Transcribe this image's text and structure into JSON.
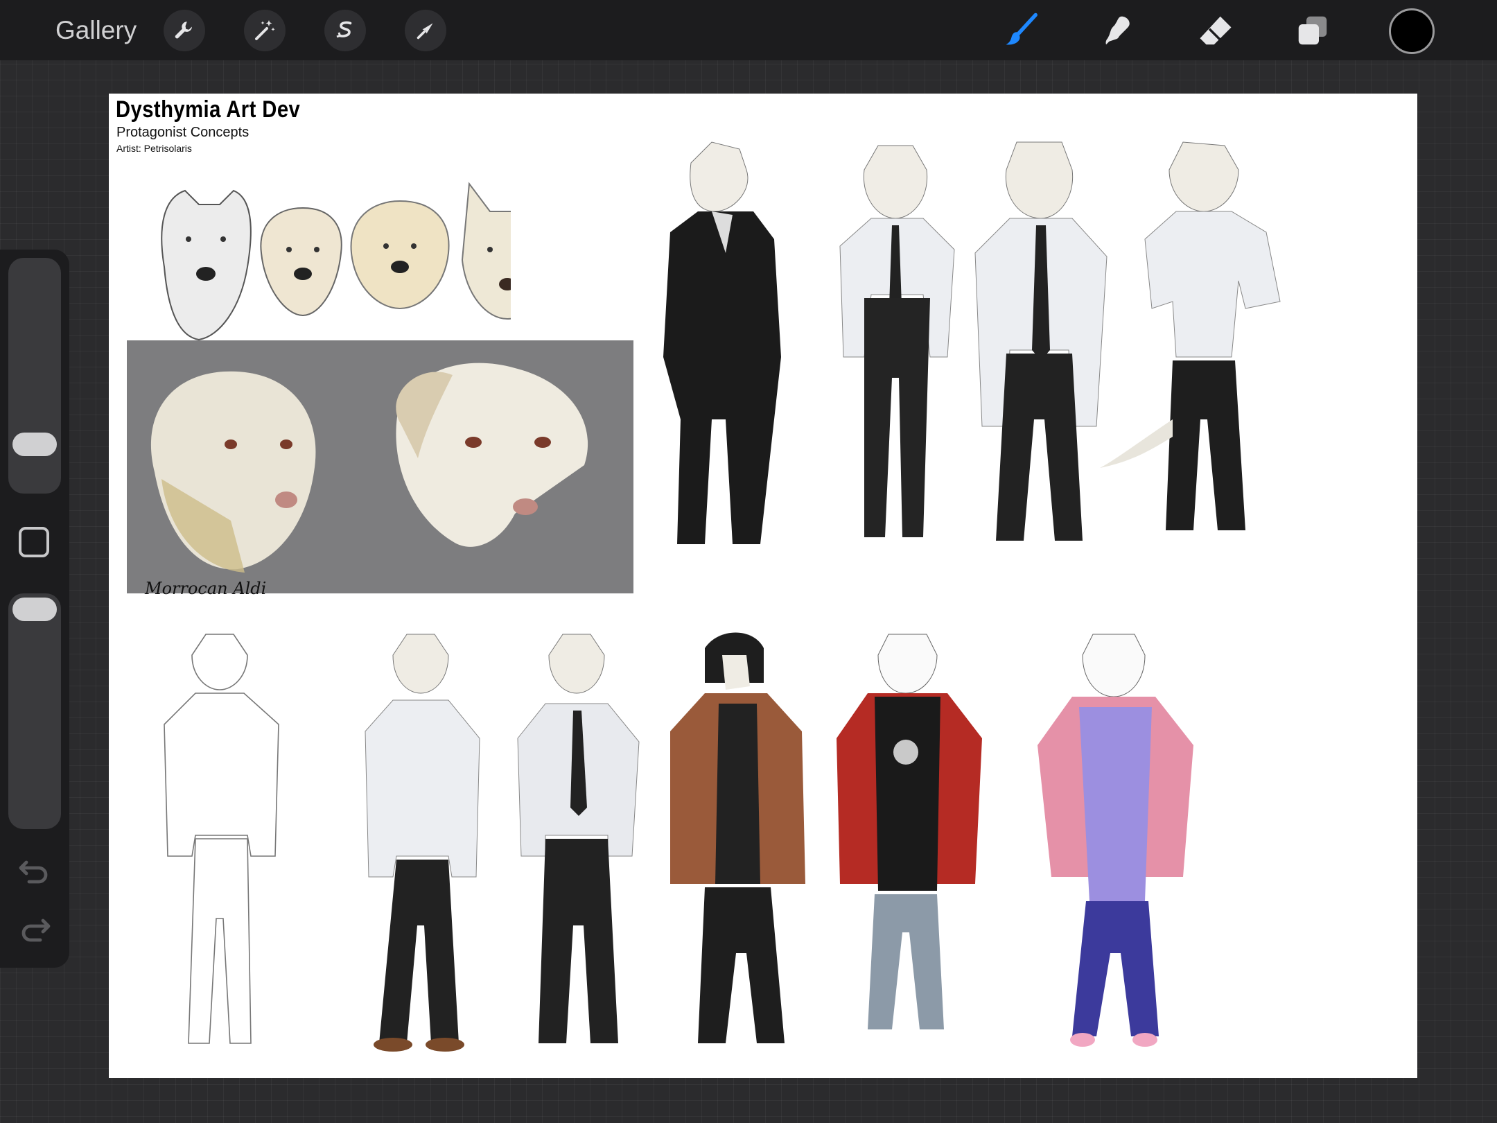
{
  "toolbar": {
    "gallery_label": "Gallery",
    "left_tools": [
      "wrench-icon",
      "magic-wand-icon",
      "selection-icon",
      "transform-icon"
    ],
    "right_tools": [
      "brush-icon",
      "smudge-icon",
      "eraser-icon",
      "layers-icon"
    ],
    "active_tool": "brush",
    "active_color": "#000000",
    "accent_color": "#1e88ff"
  },
  "sidebar": {
    "brush_size_slider": {
      "level": 0.18
    },
    "opacity_slider": {
      "level": 1.0
    },
    "buttons": [
      "modify-button",
      "undo-icon",
      "redo-icon"
    ]
  },
  "artwork": {
    "title": "Dysthymia Art Dev",
    "subtitle": "Protagonist Concepts",
    "artist": "Artist: Petrisolaris",
    "signature": "Morrocan Aldi"
  }
}
